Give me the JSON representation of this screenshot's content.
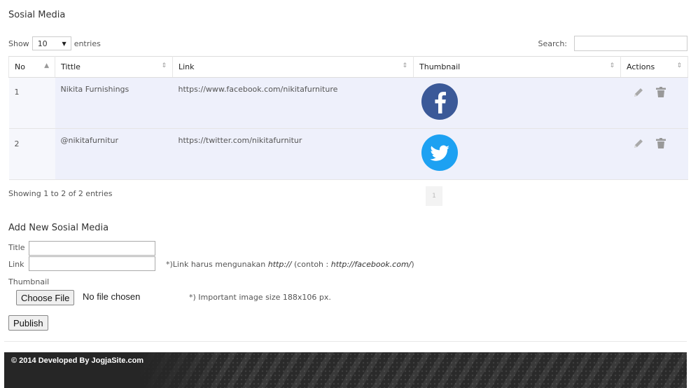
{
  "page": {
    "section_title": "Sosial Media"
  },
  "table_controls": {
    "show_label": "Show",
    "entries_value": "10",
    "entries_label": "entries",
    "search_label": "Search:",
    "search_value": ""
  },
  "table": {
    "columns": [
      "No",
      "Tittle",
      "Link",
      "Thumbnail",
      "Actions"
    ],
    "rows": [
      {
        "no": "1",
        "title": "Nikita Furnishings",
        "link": "https://www.facebook.com/nikitafurniture",
        "thumbnail": "facebook-icon"
      },
      {
        "no": "2",
        "title": "@nikitafurnitur",
        "link": "https://twitter.com/nikitafurnitur",
        "thumbnail": "twitter-icon"
      }
    ],
    "info": "Showing 1 to 2 of 2 entries",
    "current_page": "1"
  },
  "add_form": {
    "title": "Add New Sosial Media",
    "title_label": "Title",
    "link_label": "Link",
    "link_note_prefix": "*)Link harus mengunakan ",
    "link_note_protocol": "http://",
    "link_note_mid": " (contoh : ",
    "link_note_example": "http://facebook.com/",
    "link_note_suffix": ")",
    "thumbnail_label": "Thumbnail",
    "choose_file_label": "Choose File",
    "no_file_text": "No file chosen",
    "image_note": "*) Important image size 188x106 px.",
    "publish_label": "Publish"
  },
  "footer": {
    "copyright": "© 2014 Developed By JogjaSite.com"
  },
  "colors": {
    "facebook": "#3b5998",
    "twitter": "#1da1f2",
    "row_highlight": "#eef0fb"
  }
}
